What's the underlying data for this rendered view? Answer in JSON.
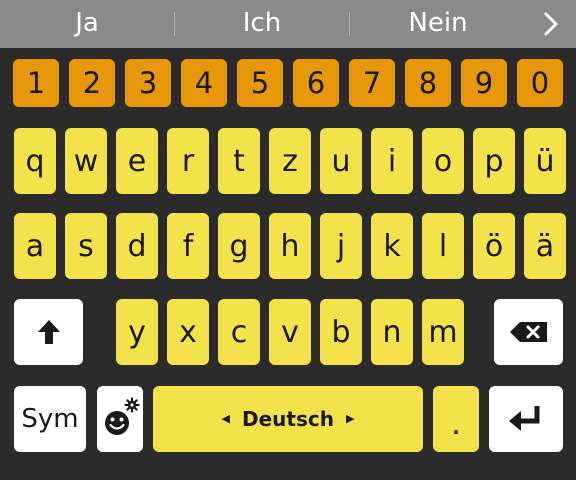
{
  "suggestions": [
    "Ja",
    "Ich",
    "Nein"
  ],
  "number_row": [
    "1",
    "2",
    "3",
    "4",
    "5",
    "6",
    "7",
    "8",
    "9",
    "0"
  ],
  "letter_row_1": [
    "q",
    "w",
    "e",
    "r",
    "t",
    "z",
    "u",
    "i",
    "o",
    "p",
    "ü"
  ],
  "letter_row_2": [
    "a",
    "s",
    "d",
    "f",
    "g",
    "h",
    "j",
    "k",
    "l",
    "ö",
    "ä"
  ],
  "letter_row_3": [
    "y",
    "x",
    "c",
    "v",
    "b",
    "n",
    "m"
  ],
  "bottom": {
    "sym_label": "Sym",
    "space_label": "Deutsch",
    "period_label": "."
  },
  "colors": {
    "background": "#2b2b2b",
    "strip": "#8a8a8a",
    "number_key": "#e6980a",
    "letter_key": "#f3e24a",
    "function_key": "#ffffff"
  },
  "icons": [
    "chevron-right-icon",
    "shift-up-arrow-icon",
    "backspace-icon",
    "emoji-settings-icon",
    "enter-icon"
  ]
}
